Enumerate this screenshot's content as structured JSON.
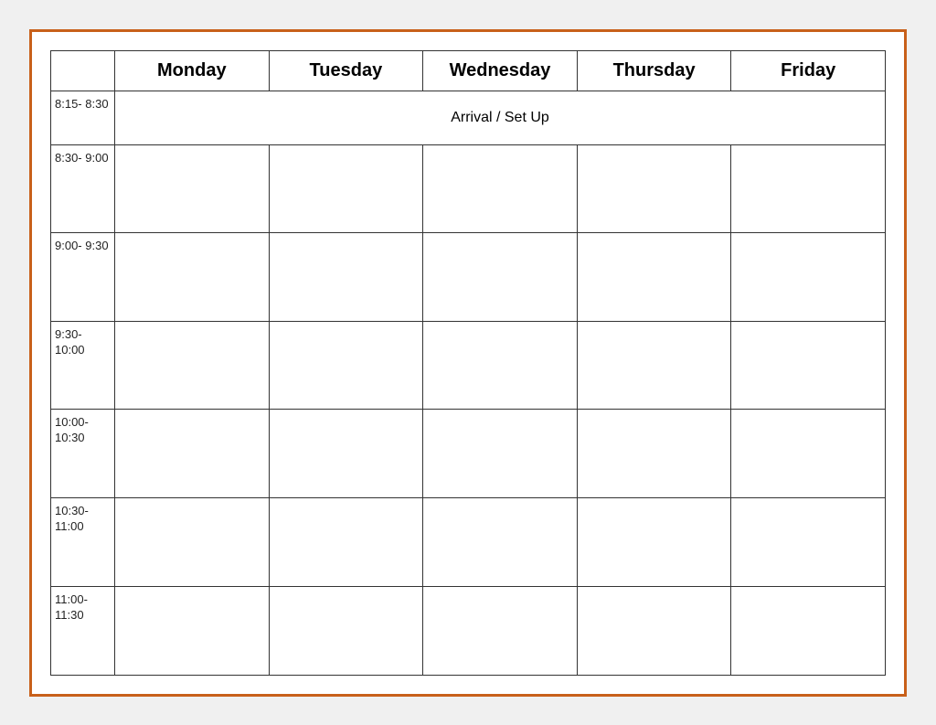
{
  "header": {
    "days": [
      "Monday",
      "Tuesday",
      "Wednesday",
      "Thursday",
      "Friday"
    ]
  },
  "rows": [
    {
      "time": "8:15-\n8:30",
      "arrival": "Arrival / Set Up",
      "isArrival": true
    },
    {
      "time": "8:30-\n9:00",
      "isArrival": false
    },
    {
      "time": "9:00-\n9:30",
      "isArrival": false
    },
    {
      "time": "9:30-\n10:00",
      "isArrival": false
    },
    {
      "time": "10:00-\n10:30",
      "isArrival": false
    },
    {
      "time": "10:30-\n11:00",
      "isArrival": false
    },
    {
      "time": "11:00-\n11:30",
      "isArrival": false
    }
  ]
}
